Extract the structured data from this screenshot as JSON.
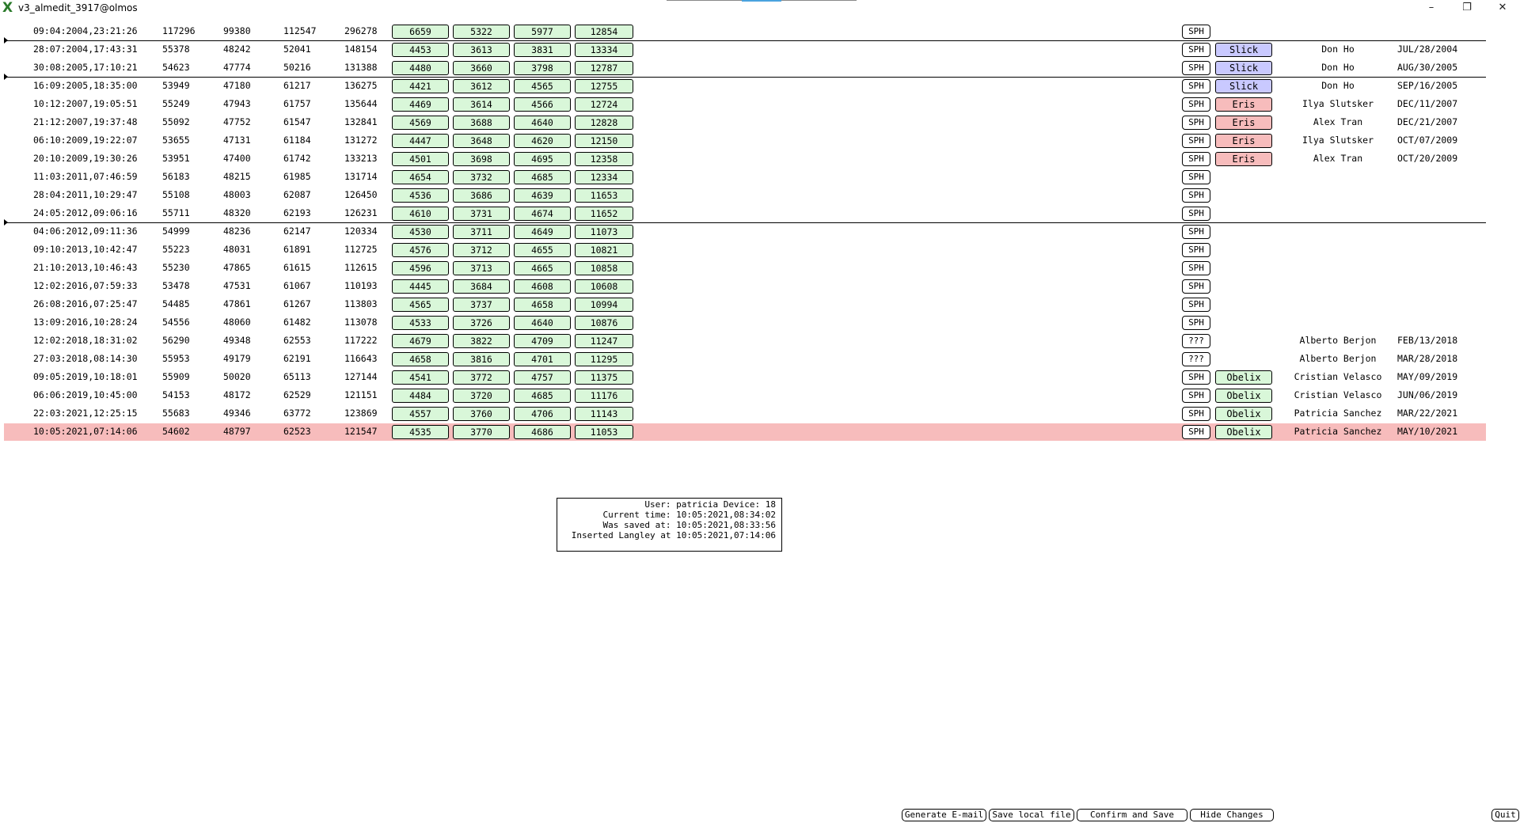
{
  "window": {
    "title": "v3_almedit_3917@olmos",
    "minimize": "–",
    "restore": "❐",
    "close": "✕",
    "app_icon": "X"
  },
  "colors": {
    "green_box": "#d9f7d9",
    "slick": "#c9c9ff",
    "eris": "#f7bcbc",
    "obelix": "#d9f7d9",
    "highlight_row": "#f7bcbc"
  },
  "rows": [
    {
      "ts": "09:04:2004,23:21:26",
      "a": "117296",
      "b": "99380",
      "c": "112547",
      "d": "296278",
      "g": [
        "6659",
        "5322",
        "5977",
        "12854"
      ],
      "sph": "SPH",
      "badge": "",
      "person": "",
      "date": ""
    },
    {
      "ts": "28:07:2004,17:43:31",
      "a": "55378",
      "b": "48242",
      "c": "52041",
      "d": "148154",
      "g": [
        "4453",
        "3613",
        "3831",
        "13334"
      ],
      "sph": "SPH",
      "badge": "Slick",
      "person": "Don Ho",
      "date": "JUL/28/2004"
    },
    {
      "ts": "30:08:2005,17:10:21",
      "a": "54623",
      "b": "47774",
      "c": "50216",
      "d": "131388",
      "g": [
        "4480",
        "3660",
        "3798",
        "12787"
      ],
      "sph": "SPH",
      "badge": "Slick",
      "person": "Don Ho",
      "date": "AUG/30/2005"
    },
    {
      "ts": "16:09:2005,18:35:00",
      "a": "53949",
      "b": "47180",
      "c": "61217",
      "d": "136275",
      "g": [
        "4421",
        "3612",
        "4565",
        "12755"
      ],
      "sph": "SPH",
      "badge": "Slick",
      "person": "Don Ho",
      "date": "SEP/16/2005"
    },
    {
      "ts": "10:12:2007,19:05:51",
      "a": "55249",
      "b": "47943",
      "c": "61757",
      "d": "135644",
      "g": [
        "4469",
        "3614",
        "4566",
        "12724"
      ],
      "sph": "SPH",
      "badge": "Eris",
      "person": "Ilya Slutsker",
      "date": "DEC/11/2007"
    },
    {
      "ts": "21:12:2007,19:37:48",
      "a": "55092",
      "b": "47752",
      "c": "61547",
      "d": "132841",
      "g": [
        "4569",
        "3688",
        "4640",
        "12828"
      ],
      "sph": "SPH",
      "badge": "Eris",
      "person": "Alex Tran",
      "date": "DEC/21/2007"
    },
    {
      "ts": "06:10:2009,19:22:07",
      "a": "53655",
      "b": "47131",
      "c": "61184",
      "d": "131272",
      "g": [
        "4447",
        "3648",
        "4620",
        "12150"
      ],
      "sph": "SPH",
      "badge": "Eris",
      "person": "Ilya Slutsker",
      "date": "OCT/07/2009"
    },
    {
      "ts": "20:10:2009,19:30:26",
      "a": "53951",
      "b": "47400",
      "c": "61742",
      "d": "133213",
      "g": [
        "4501",
        "3698",
        "4695",
        "12358"
      ],
      "sph": "SPH",
      "badge": "Eris",
      "person": "Alex Tran",
      "date": "OCT/20/2009"
    },
    {
      "ts": "11:03:2011,07:46:59",
      "a": "56183",
      "b": "48215",
      "c": "61985",
      "d": "131714",
      "g": [
        "4654",
        "3732",
        "4685",
        "12334"
      ],
      "sph": "SPH",
      "badge": "",
      "person": "",
      "date": ""
    },
    {
      "ts": "28:04:2011,10:29:47",
      "a": "55108",
      "b": "48003",
      "c": "62087",
      "d": "126450",
      "g": [
        "4536",
        "3686",
        "4639",
        "11653"
      ],
      "sph": "SPH",
      "badge": "",
      "person": "",
      "date": ""
    },
    {
      "ts": "24:05:2012,09:06:16",
      "a": "55711",
      "b": "48320",
      "c": "62193",
      "d": "126231",
      "g": [
        "4610",
        "3731",
        "4674",
        "11652"
      ],
      "sph": "SPH",
      "badge": "",
      "person": "",
      "date": ""
    },
    {
      "ts": "04:06:2012,09:11:36",
      "a": "54999",
      "b": "48236",
      "c": "62147",
      "d": "120334",
      "g": [
        "4530",
        "3711",
        "4649",
        "11073"
      ],
      "sph": "SPH",
      "badge": "",
      "person": "",
      "date": ""
    },
    {
      "ts": "09:10:2013,10:42:47",
      "a": "55223",
      "b": "48031",
      "c": "61891",
      "d": "112725",
      "g": [
        "4576",
        "3712",
        "4655",
        "10821"
      ],
      "sph": "SPH",
      "badge": "",
      "person": "",
      "date": ""
    },
    {
      "ts": "21:10:2013,10:46:43",
      "a": "55230",
      "b": "47865",
      "c": "61615",
      "d": "112615",
      "g": [
        "4596",
        "3713",
        "4665",
        "10858"
      ],
      "sph": "SPH",
      "badge": "",
      "person": "",
      "date": ""
    },
    {
      "ts": "12:02:2016,07:59:33",
      "a": "53478",
      "b": "47531",
      "c": "61067",
      "d": "110193",
      "g": [
        "4445",
        "3684",
        "4608",
        "10608"
      ],
      "sph": "SPH",
      "badge": "",
      "person": "",
      "date": ""
    },
    {
      "ts": "26:08:2016,07:25:47",
      "a": "54485",
      "b": "47861",
      "c": "61267",
      "d": "113803",
      "g": [
        "4565",
        "3737",
        "4658",
        "10994"
      ],
      "sph": "SPH",
      "badge": "",
      "person": "",
      "date": ""
    },
    {
      "ts": "13:09:2016,10:28:24",
      "a": "54556",
      "b": "48060",
      "c": "61482",
      "d": "113078",
      "g": [
        "4533",
        "3726",
        "4640",
        "10876"
      ],
      "sph": "SPH",
      "badge": "",
      "person": "",
      "date": ""
    },
    {
      "ts": "12:02:2018,18:31:02",
      "a": "56290",
      "b": "49348",
      "c": "62553",
      "d": "117222",
      "g": [
        "4679",
        "3822",
        "4709",
        "11247"
      ],
      "sph": "???",
      "badge": "",
      "person": "Alberto Berjon",
      "date": "FEB/13/2018"
    },
    {
      "ts": "27:03:2018,08:14:30",
      "a": "55953",
      "b": "49179",
      "c": "62191",
      "d": "116643",
      "g": [
        "4658",
        "3816",
        "4701",
        "11295"
      ],
      "sph": "???",
      "badge": "",
      "person": "Alberto Berjon",
      "date": "MAR/28/2018"
    },
    {
      "ts": "09:05:2019,10:18:01",
      "a": "55909",
      "b": "50020",
      "c": "65113",
      "d": "127144",
      "g": [
        "4541",
        "3772",
        "4757",
        "11375"
      ],
      "sph": "SPH",
      "badge": "Obelix",
      "person": "Cristian Velasco",
      "date": "MAY/09/2019"
    },
    {
      "ts": "06:06:2019,10:45:00",
      "a": "54153",
      "b": "48172",
      "c": "62529",
      "d": "121151",
      "g": [
        "4484",
        "3720",
        "4685",
        "11176"
      ],
      "sph": "SPH",
      "badge": "Obelix",
      "person": "Cristian Velasco",
      "date": "JUN/06/2019"
    },
    {
      "ts": "22:03:2021,12:25:15",
      "a": "55683",
      "b": "49346",
      "c": "63772",
      "d": "123869",
      "g": [
        "4557",
        "3760",
        "4706",
        "11143"
      ],
      "sph": "SPH",
      "badge": "Obelix",
      "person": "Patricia Sanchez",
      "date": "MAR/22/2021"
    },
    {
      "ts": "10:05:2021,07:14:06",
      "a": "54602",
      "b": "48797",
      "c": "62523",
      "d": "121547",
      "g": [
        "4535",
        "3770",
        "4686",
        "11053"
      ],
      "sph": "SPH",
      "badge": "Obelix",
      "person": "Patricia Sanchez",
      "date": "MAY/10/2021",
      "highlight": true
    }
  ],
  "separators_after_rows": [
    0,
    2,
    10
  ],
  "info": {
    "line1": "User: patricia Device: 18",
    "line2": "Current time: 10:05:2021,08:34:02",
    "line3": "Was saved at: 10:05:2021,08:33:56",
    "line4": "Inserted Langley at 10:05:2021,07:14:06"
  },
  "buttons": {
    "generate_email": "Generate E-mail",
    "save_local": "Save local file",
    "confirm_save": "Confirm and Save",
    "hide_changes": "Hide Changes",
    "quit": "Quit"
  }
}
